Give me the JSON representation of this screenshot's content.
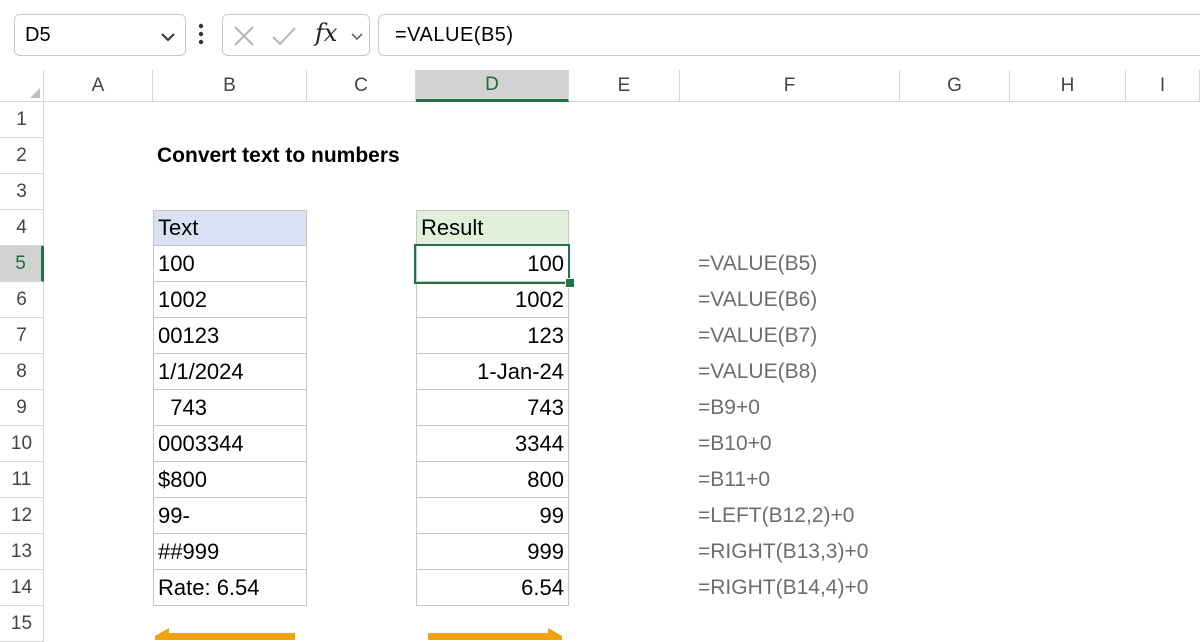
{
  "formula_bar": {
    "name_box": "D5",
    "formula": "=VALUE(B5)",
    "fx_label": "fx",
    "cancel_glyph": "✕",
    "enter_glyph": "✓",
    "dots": "⋮",
    "icons": [
      "chevron-down-icon",
      "more-icon",
      "cancel-icon",
      "enter-icon",
      "fx-icon"
    ]
  },
  "sheet": {
    "columns": [
      "A",
      "B",
      "C",
      "D",
      "E",
      "F",
      "G",
      "H",
      "I"
    ],
    "rows": [
      "1",
      "2",
      "3",
      "4",
      "5",
      "6",
      "7",
      "8",
      "9",
      "10",
      "11",
      "12",
      "13",
      "14",
      "15"
    ],
    "selected_column": "D",
    "selected_row": "5",
    "title": "Convert text to numbers",
    "text_header": "Text",
    "result_header": "Result",
    "text_values": [
      "100",
      "1002",
      "00123",
      "1/1/2024",
      "  743",
      "0003344",
      "$800",
      "99-",
      "##999",
      "Rate: 6.54"
    ],
    "result_values": [
      "100",
      "1002",
      "123",
      "1-Jan-24",
      "743",
      "3344",
      "800",
      "99",
      "999",
      "6.54"
    ],
    "formulas": [
      "=VALUE(B5)",
      "=VALUE(B6)",
      "=VALUE(B7)",
      "=VALUE(B8)",
      "=B9+0",
      "=B10+0",
      "=B11+0",
      "=LEFT(B12,2)+0",
      "=RIGHT(B13,3)+0",
      "=RIGHT(B14,4)+0"
    ],
    "colors": {
      "text_header_fill": "#d9e1f2",
      "result_header_fill": "#e2efda",
      "selection_green": "#217346",
      "formula_gray": "#6d6d6d",
      "arrow_orange": "#f0a30a"
    }
  }
}
